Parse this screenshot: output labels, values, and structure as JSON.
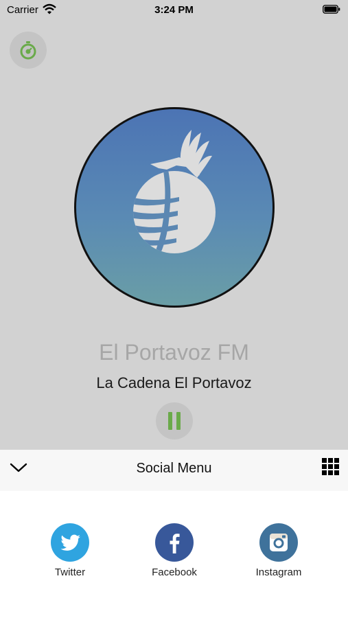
{
  "status_bar": {
    "carrier": "Carrier",
    "time": "3:24 PM"
  },
  "player": {
    "station_name": "El Portavoz FM",
    "track_name": "La Cadena El Portavoz",
    "state": "playing"
  },
  "social_menu": {
    "title": "Social Menu",
    "items": [
      {
        "label": "Twitter",
        "icon": "twitter-icon",
        "color": "#2fa4e0"
      },
      {
        "label": "Facebook",
        "icon": "facebook-icon",
        "color": "#38589a"
      },
      {
        "label": "Instagram",
        "icon": "instagram-icon",
        "color": "#3f729b"
      }
    ]
  },
  "colors": {
    "player_background": "#d2d2d2",
    "accent_green": "#6aaa4a",
    "station_name": "#a6a6a6"
  }
}
